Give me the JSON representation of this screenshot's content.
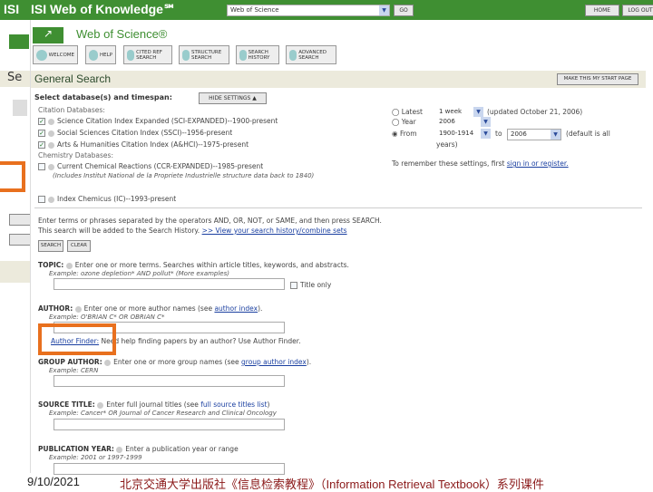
{
  "header": {
    "brand_back": "ISI",
    "brand": "ISI Web of Knowledge℠",
    "db_select": "Web of Science",
    "go": "GO",
    "home": "HOME",
    "logout": "LOG OUT"
  },
  "wos": {
    "title": "Web of Science®"
  },
  "toolbar": [
    {
      "label": "WELCOME"
    },
    {
      "label": "HELP"
    },
    {
      "label": "CITED REF SEARCH"
    },
    {
      "label": "STRUCTURE SEARCH"
    },
    {
      "label": "SEARCH HISTORY"
    },
    {
      "label": "ADVANCED SEARCH"
    }
  ],
  "general": {
    "title": "General Search",
    "start_page": "MAKE THIS MY START PAGE",
    "back_title": "Se"
  },
  "databases": {
    "heading": "Select database(s) and timespan:",
    "hide": "HIDE SETTINGS ▲",
    "citation_heading": "Citation Databases:",
    "citation": [
      "Science Citation Index Expanded (SCI-EXPANDED)--1900-present",
      "Social Sciences Citation Index (SSCI)--1956-present",
      "Arts & Humanities Citation Index (A&HCI)--1975-present"
    ],
    "chemistry_heading": "Chemistry Databases:",
    "ccr": "Current Chemical Reactions (CCR-EXPANDED)--1985-present",
    "ccr_note": "(Includes Institut National de la Propriete Industrielle structure data back to 1840)",
    "ic": "Index Chemicus (IC)--1993-present"
  },
  "timespan": {
    "latest": "Latest",
    "latest_val": "1 week",
    "updated": "(updated October 21, 2006)",
    "year": "Year",
    "year_val": "2006",
    "from": "From",
    "from_val": "1900-1914",
    "to": "to",
    "to_val": "2006",
    "default": "(default is all",
    "default2": "years)",
    "remember": "To remember these settings, first",
    "remember_link": "sign in or register."
  },
  "search": {
    "instructions": "Enter terms or phrases separated by the operators AND, OR, NOT, or SAME, and then press SEARCH.",
    "instructions2": "This search will be added to the Search History.",
    "history_link": ">> View your search history/combine sets",
    "search_btn": "SEARCH",
    "clear_btn": "CLEAR",
    "topic": "TOPIC:",
    "topic_desc": "Enter one or more terms. Searches within article titles, keywords, and abstracts.",
    "topic_ex": "Example: ozone depletion* AND pollut* (More examples)",
    "title_only": "Title only",
    "author": "AUTHOR:",
    "author_desc": "Enter one or more author names (see",
    "author_link": "author index",
    "author_ex": "Example: O'BRIAN C* OR OBRIAN C*",
    "finder_link": "Author Finder:",
    "finder_desc": "Need help finding papers by an author? Use Author Finder.",
    "group": "GROUP AUTHOR:",
    "group_desc": "Enter one or more group names (see",
    "group_link": "group author index",
    "group_ex": "Example: CERN",
    "source": "SOURCE TITLE:",
    "source_desc": "Enter full journal titles (see",
    "source_link": "full source titles list",
    "source_ex": "Example: Cancer* OR Journal of Cancer Research and Clinical Oncology",
    "pubyear": "PUBLICATION YEAR:",
    "pubyear_desc": "Enter a publication year or range",
    "pubyear_ex": "Example: 2001 or 1997-1999"
  },
  "footer": {
    "date": "9/10/2021",
    "caption": "北京交通大学出版社《信息检索教程》（Information Retrieval Textbook）系列课件"
  }
}
